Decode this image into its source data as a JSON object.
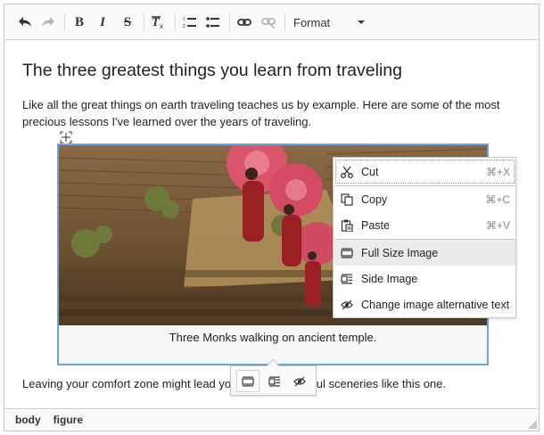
{
  "toolbar": {
    "buttons": [
      {
        "name": "undo",
        "state": "enabled"
      },
      {
        "name": "redo",
        "state": "disabled"
      },
      {
        "name": "bold",
        "label": "B"
      },
      {
        "name": "italic",
        "label": "I"
      },
      {
        "name": "strikethrough",
        "label": "S"
      },
      {
        "name": "remove-format"
      },
      {
        "name": "numbered-list"
      },
      {
        "name": "bulleted-list"
      },
      {
        "name": "link",
        "state": "enabled"
      },
      {
        "name": "unlink",
        "state": "disabled"
      }
    ],
    "format_label": "Format"
  },
  "document": {
    "title": "The three greatest things you learn from traveling",
    "paragraph1": "Like all the great things on earth traveling teaches us by example. Here are some of the most precious lessons I've learned over the years of traveling.",
    "figure_caption": "Three Monks walking on ancient temple.",
    "paragraph2_start": "Leaving your comfort zone might lead yo",
    "paragraph2_end": "ful sceneries like this one."
  },
  "context_menu": {
    "items": [
      {
        "label": "Cut",
        "shortcut": "⌘+X",
        "icon": "scissors-icon"
      },
      {
        "label": "Copy",
        "shortcut": "⌘+C",
        "icon": "copy-icon"
      },
      {
        "label": "Paste",
        "shortcut": "⌘+V",
        "icon": "paste-icon"
      },
      {
        "label": "Full Size Image",
        "shortcut": "",
        "icon": "full-size-image-icon",
        "active": true
      },
      {
        "label": "Side Image",
        "shortcut": "",
        "icon": "side-image-icon"
      },
      {
        "label": "Change image alternative text",
        "shortcut": "",
        "icon": "alt-text-icon"
      }
    ]
  },
  "balloon_toolbar": {
    "buttons": [
      "full-size-image-icon",
      "side-image-icon",
      "alt-text-icon"
    ],
    "active": "full-size-image-icon"
  },
  "status_bar": {
    "path": [
      "body",
      "figure"
    ]
  },
  "colors": {
    "selection_border": "#6ba5d7",
    "active_menu_bg": "#ebebeb",
    "toolbar_bg": "#fafafa"
  }
}
